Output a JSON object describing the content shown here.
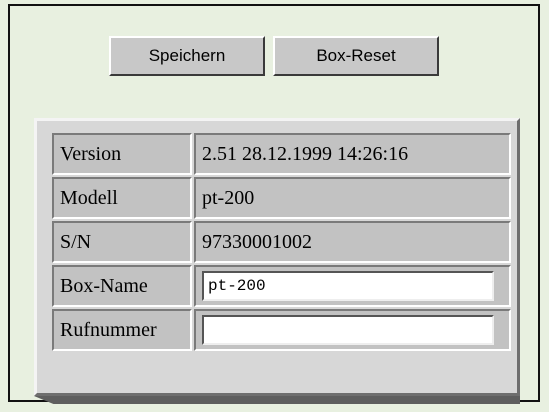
{
  "buttons": {
    "save_label": "Speichern",
    "reset_label": "Box-Reset"
  },
  "info": {
    "version_label": "Version",
    "version_value": "2.51 28.12.1999 14:26:16",
    "model_label": "Modell",
    "model_value": "pt-200",
    "serial_label": "S/N",
    "serial_value": "97330001002",
    "boxname_label": "Box-Name",
    "boxname_value": "pt-200",
    "phone_label": "Rufnummer",
    "phone_value": ""
  }
}
